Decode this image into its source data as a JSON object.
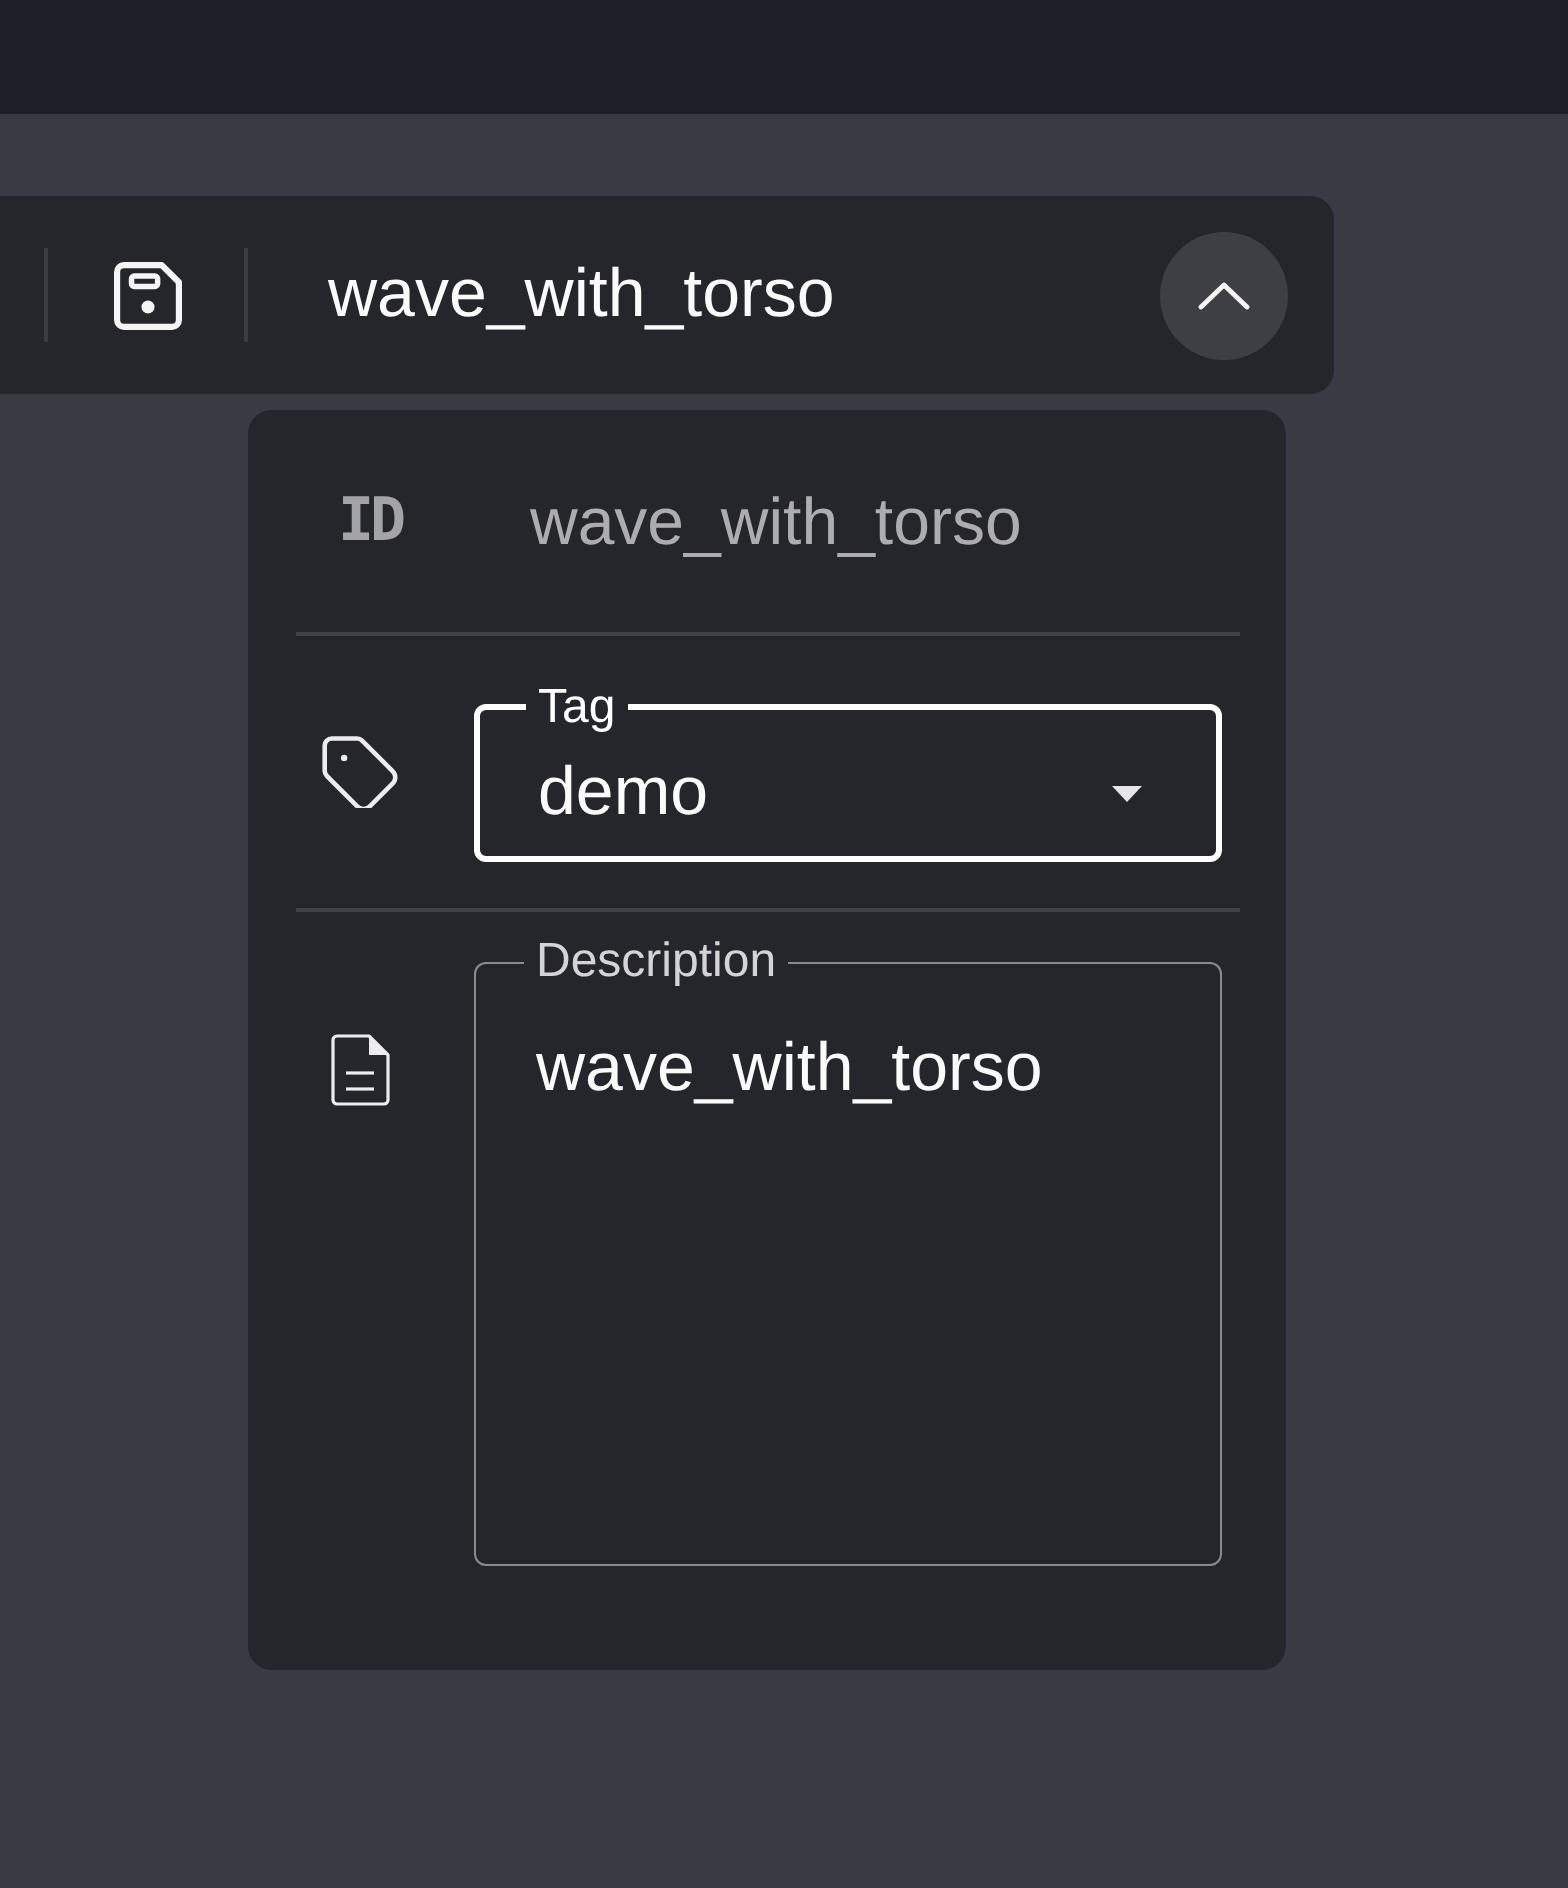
{
  "toolbar": {
    "title": "wave_with_torso",
    "expanded": true
  },
  "details": {
    "id": {
      "icon_text": "ID",
      "value": "wave_with_torso"
    },
    "tag": {
      "label": "Tag",
      "value": "demo",
      "focused": true
    },
    "description": {
      "label": "Description",
      "value": "wave_with_torso",
      "focused": false
    }
  }
}
